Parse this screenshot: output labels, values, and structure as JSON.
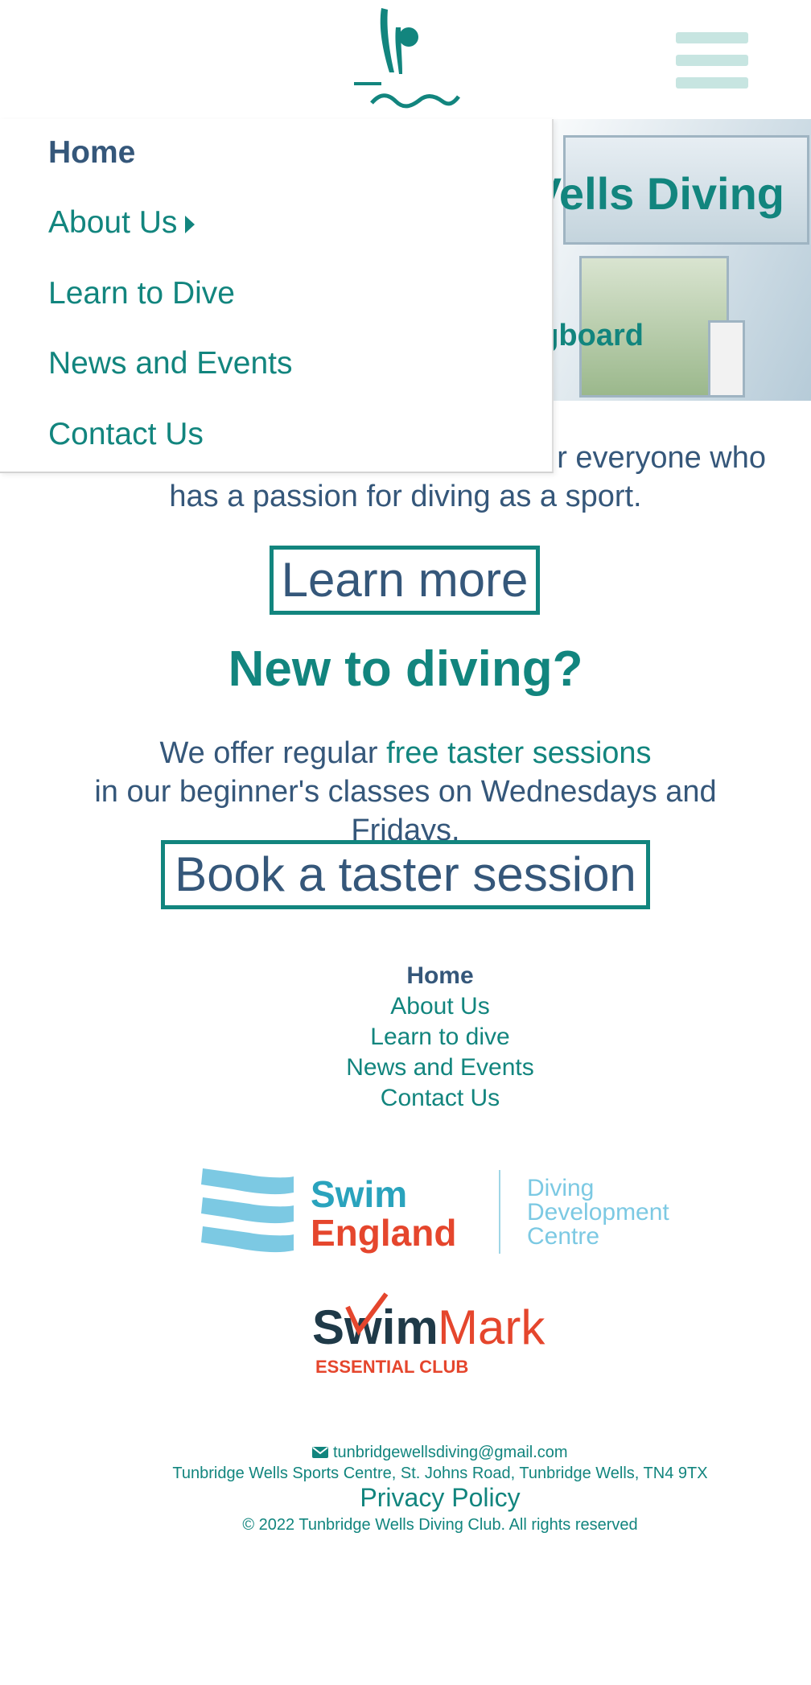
{
  "header": {
    "logo_icon": "diver-logo-icon",
    "menu_icon": "hamburger-menu-icon"
  },
  "hero": {
    "title_visible": "Vells Diving",
    "subtitle_visible": "gboard"
  },
  "menu": {
    "items": [
      {
        "label": "Home"
      },
      {
        "label": "About Us"
      },
      {
        "label": "Learn to Dive"
      },
      {
        "label": "News and Events"
      },
      {
        "label": "Contact Us"
      }
    ]
  },
  "intro": {
    "line1_visible": "r everyone who",
    "line2": "has a passion for diving as a sport.",
    "button_label": "Learn more"
  },
  "beginners": {
    "heading": "New to diving?",
    "text_before": "We offer regular ",
    "link_text": "free taster sessions",
    "text_after": " in our beginner's classes on Wednesdays and Fridays.",
    "button_label": "Book a taster session"
  },
  "footer_nav": {
    "items": [
      {
        "label": "Home"
      },
      {
        "label": "About Us"
      },
      {
        "label": "Learn to dive"
      },
      {
        "label": "News and Events"
      },
      {
        "label": "Contact Us"
      }
    ]
  },
  "logos": {
    "swim_england_1": "Swim",
    "swim_england_2": "England",
    "ddc_1": "Diving",
    "ddc_2": "Development",
    "ddc_3": "Centre",
    "swimmark_1": "Swim",
    "swimmark_2": "Mark",
    "swimmark_3": "ESSENTIAL CLUB"
  },
  "contact": {
    "email_icon": "envelope-icon",
    "email": "tunbridgewellsdiving@gmail.com",
    "address": "Tunbridge Wells Sports Centre, St. Johns Road, Tunbridge Wells, TN4 9TX",
    "privacy_label": "Privacy Policy",
    "copyright": "© 2022 Tunbridge Wells Diving Club. All rights reserved"
  },
  "colors": {
    "teal": "#12857e",
    "navy": "#35577a",
    "light_teal": "#c7e5e1",
    "swim_blue": "#7cc9e3",
    "swim_red": "#e5462d"
  }
}
